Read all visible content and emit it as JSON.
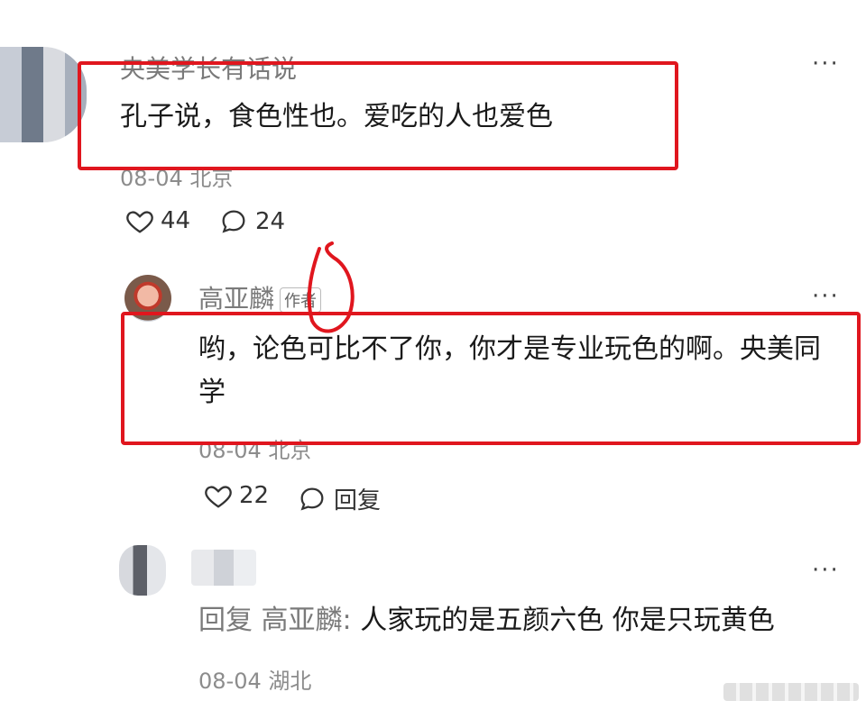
{
  "comments": [
    {
      "name": "央美学长有话说",
      "text": "孔子说，食色性也。爱吃的人也爱色",
      "meta": "08-04 北京",
      "likes": "44",
      "replies": "24",
      "more": "···"
    },
    {
      "name": "高亚麟",
      "badge": "作者",
      "text": "哟，论色可比不了你，你才是专业玩色的啊。央美同学",
      "meta": "08-04 北京",
      "likes": "22",
      "reply_label": "回复",
      "more": "···"
    },
    {
      "reply_prefix": "回复",
      "reply_target": "高亚麟:",
      "text": "人家玩的是五颜六色 你是只玩黄色",
      "meta": "08-04 湖北",
      "more": "···"
    }
  ],
  "colors": {
    "annotation": "#e0161e",
    "meta": "#8c8c8c"
  }
}
